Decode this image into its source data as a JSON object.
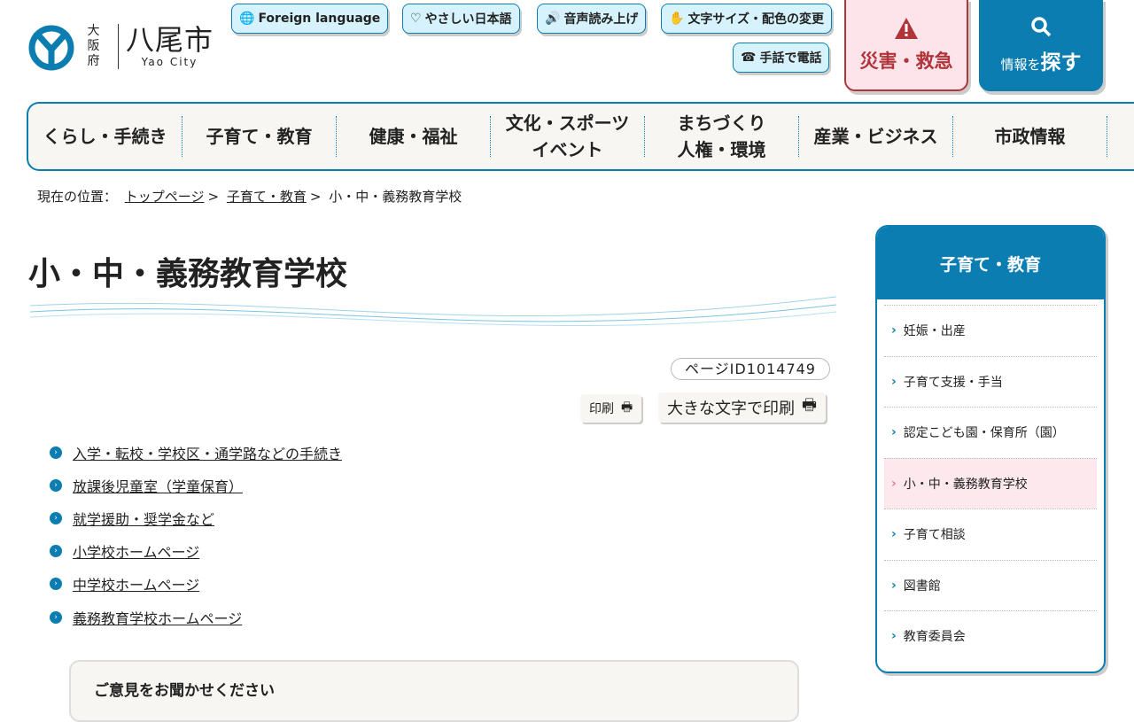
{
  "header": {
    "logo": {
      "prefecture": "大阪府",
      "city": "八尾市",
      "city_en": "Yao City"
    },
    "tools": [
      {
        "label": "Foreign language",
        "icon": "globe-icon"
      },
      {
        "label": "やさしい日本語",
        "icon": "heart-icon"
      },
      {
        "label": "音声読み上げ",
        "icon": "speaker-icon"
      },
      {
        "label": "文字サイズ・配色の変更",
        "icon": "hand-icon"
      },
      {
        "label": "手話で電話",
        "icon": "sign-language-icon"
      }
    ],
    "emergency": "災害・救急",
    "search_small": "情報を",
    "search_big": "探す"
  },
  "colors": {
    "accent": "#0b7db0",
    "emergency": "#b0353a",
    "emergency_bg": "#fde3ea"
  },
  "nav": [
    "くらし・手続き",
    "子育て・教育",
    "健康・福祉",
    "文化・スポーツ\nイベント",
    "まちづくり\n人権・環境",
    "産業・ビジネス",
    "市政情報"
  ],
  "breadcrumb": {
    "label": "現在の位置：",
    "items": [
      "トップページ",
      "子育て・教育"
    ],
    "current": "小・中・義務教育学校",
    "sep": ">"
  },
  "page": {
    "title": "小・中・義務教育学校",
    "page_id": "ページID1014749",
    "print": "印刷",
    "print_large": "大きな文字で印刷",
    "links": [
      "入学・転校・学校区・通学路などの手続き",
      "放課後児童室（学童保育）",
      "就学援助・奨学金など",
      "小学校ホームページ",
      "中学校ホームページ",
      "義務教育学校ホームページ"
    ],
    "opinion": "ご意見をお聞かせください"
  },
  "sidebar": {
    "title": "子育て・教育",
    "items": [
      "妊娠・出産",
      "子育て支援・手当",
      "認定こども園・保育所（園）",
      "小・中・義務教育学校",
      "子育て相談",
      "図書館",
      "教育委員会"
    ],
    "active": 3
  }
}
